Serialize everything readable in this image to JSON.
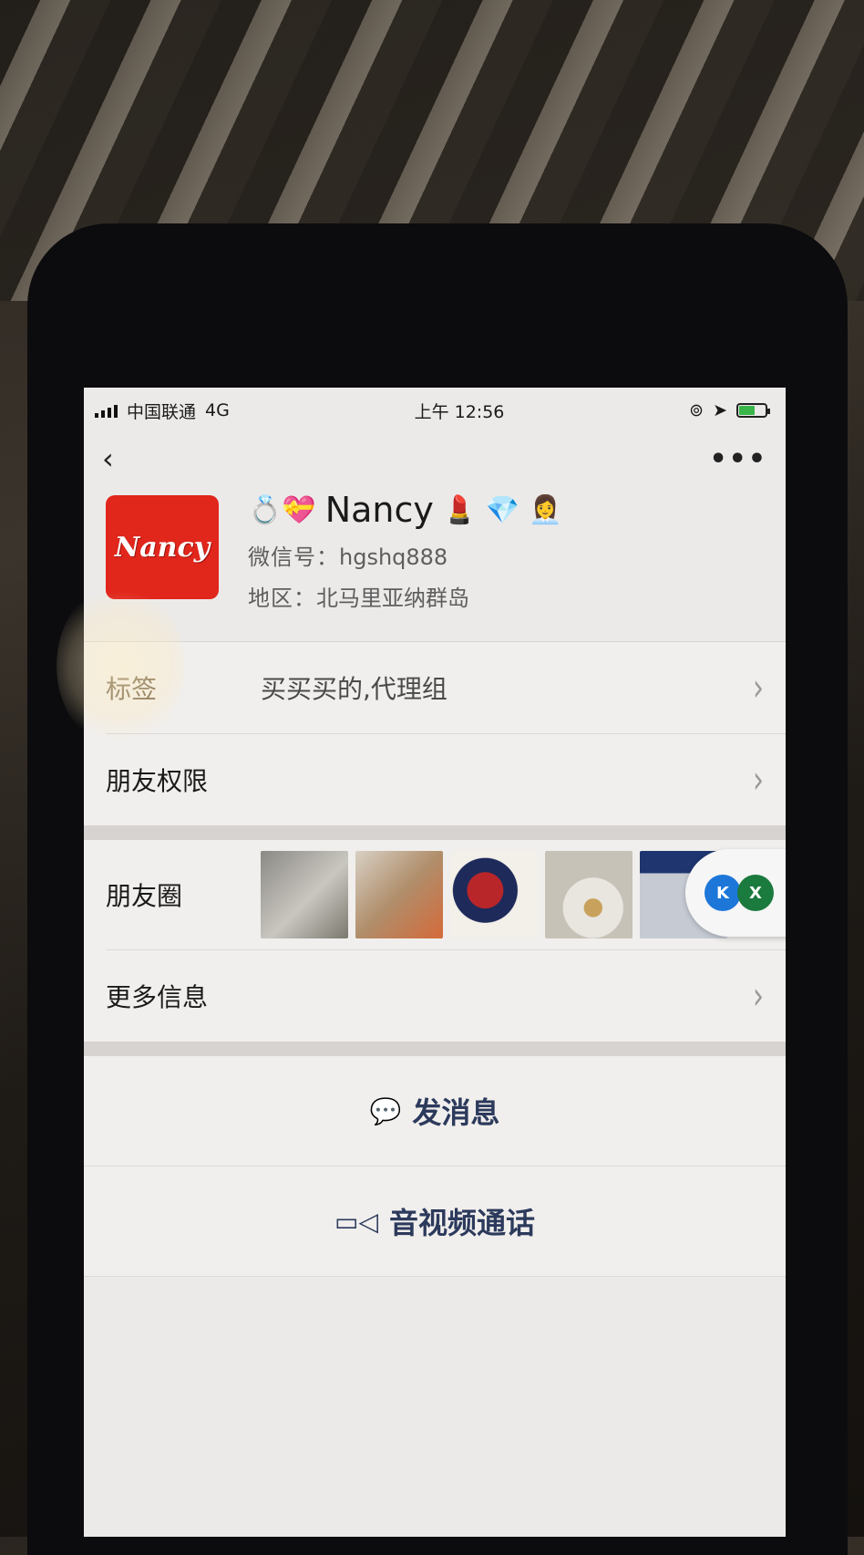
{
  "status_bar": {
    "carrier": "中国联通",
    "network": "4G",
    "time": "上午 12:56"
  },
  "nav": {
    "back_glyph": "‹",
    "more_glyph": "•••"
  },
  "profile": {
    "avatar_text": "Nancy",
    "name": "Nancy",
    "name_prefix_emoji": "💍💝",
    "name_suffix_emoji": "💄 💎 👩‍💼",
    "wechat_id_label": "微信号：",
    "wechat_id": "hgshq888",
    "region_label": "地区：",
    "region": "北马里亚纳群岛"
  },
  "rows": {
    "tags_label": "标签",
    "tags_value": "买买买的,代理组",
    "permissions_label": "朋友权限",
    "moments_label": "朋友圈",
    "more_info_label": "更多信息"
  },
  "floating": {
    "left_badge": "K",
    "right_badge": "X"
  },
  "actions": {
    "message_label": "发消息",
    "call_label": "音视频通话"
  },
  "colors": {
    "avatar_bg": "#e1261c",
    "action_text": "#2c3a5c",
    "battery_fill": "#39b54a"
  }
}
